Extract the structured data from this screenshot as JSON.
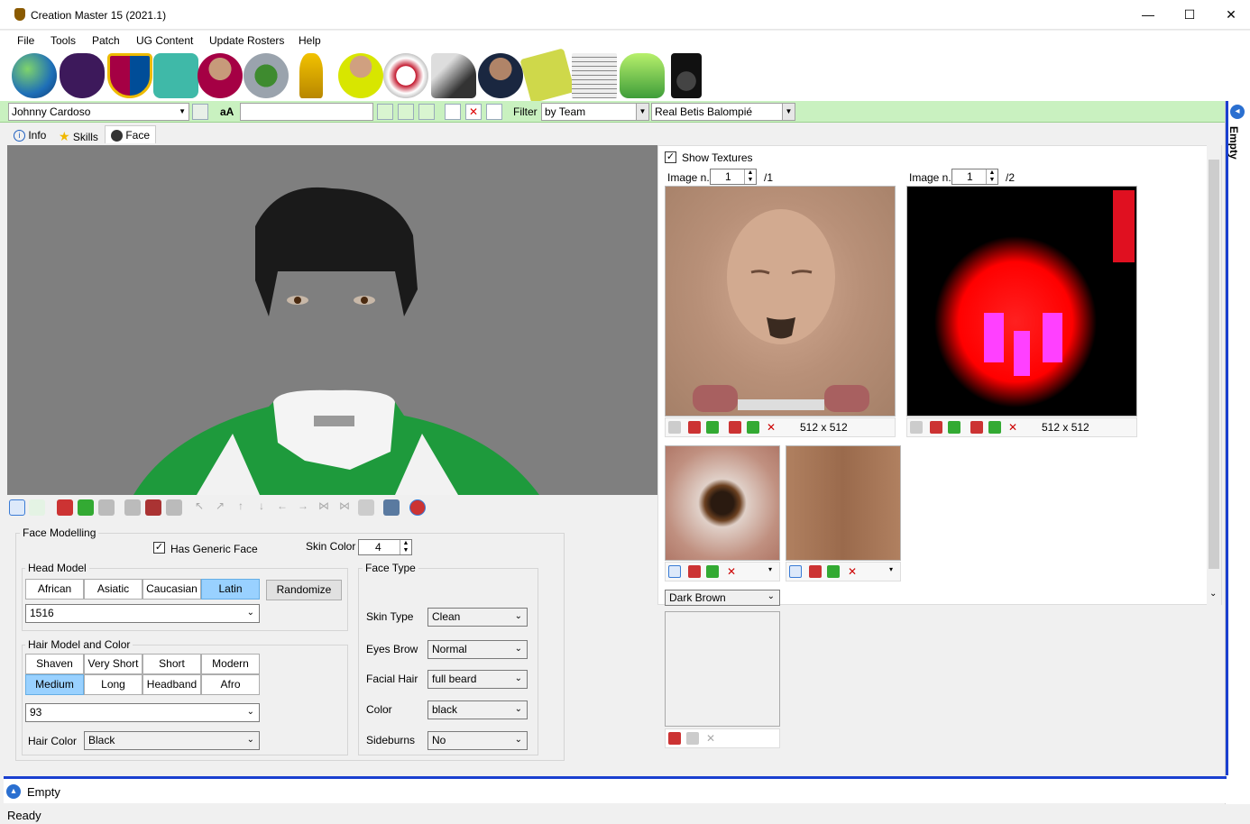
{
  "window": {
    "title": "Creation Master 15 (2021.1)",
    "minimize": "—",
    "maximize": "☐",
    "close": "✕"
  },
  "menu": {
    "items": [
      "File",
      "Tools",
      "Patch",
      "UG Content",
      "Update Rosters",
      "Help"
    ]
  },
  "toolbar_icons": [
    "world-icon",
    "premier-league-icon",
    "fcb-crest-icon",
    "kit-icon",
    "player-icon",
    "stadium-icon",
    "trophy-icon",
    "referee-icon",
    "ball-icon",
    "boot-icon",
    "manager-icon",
    "formation-icon",
    "newspaper-icon",
    "gloves-icon",
    "speaker-icon"
  ],
  "toolbar": {
    "player_name": "Johnny Cardoso",
    "font_toggle": "aA",
    "filter_label": "Filter",
    "filter_value": "by Team",
    "team_value": "Real Betis Balompié"
  },
  "tabs": [
    "Info",
    "Skills",
    "Face"
  ],
  "face_modelling": {
    "group_label": "Face Modelling",
    "has_generic_face": "Has Generic Face",
    "skin_color_label": "Skin Color",
    "skin_color_value": "4",
    "head_model": {
      "label": "Head Model",
      "buttons": [
        "African",
        "Asiatic",
        "Caucasian",
        "Latin"
      ],
      "selected": "Latin",
      "randomize": "Randomize",
      "value": "1516"
    },
    "hair": {
      "label": "Hair Model and Color",
      "row1": [
        "Shaven",
        "Very Short",
        "Short",
        "Modern"
      ],
      "row2": [
        "Medium",
        "Long",
        "Headband",
        "Afro"
      ],
      "selected": "Medium",
      "value": "93",
      "color_label": "Hair Color",
      "color_value": "Black"
    },
    "face_type": {
      "label": "Face Type",
      "skin_type_label": "Skin Type",
      "skin_type": "Clean",
      "eyebrow_label": "Eyes Brow",
      "eyebrow": "Normal",
      "facial_hair_label": "Facial Hair",
      "facial_hair": "full beard",
      "color_label": "Color",
      "color": "black",
      "sideburns_label": "Sideburns",
      "sideburns": "No"
    }
  },
  "textures": {
    "show_textures": "Show Textures",
    "image_label": "Image n.",
    "left": {
      "index": "1",
      "total": "/1",
      "size": "512 x 512"
    },
    "right": {
      "index": "1",
      "total": "/2",
      "size": "512 x 512"
    },
    "eye_color": "Dark Brown"
  },
  "bottom_dock": {
    "label": "Empty"
  },
  "side_dock": {
    "label": "Empty"
  },
  "status": {
    "text": "Ready"
  },
  "colors": {
    "toolbar_green": "#c9f1c0",
    "selected_blue": "#99d1ff",
    "dock_blue": "#1a3fd0"
  }
}
